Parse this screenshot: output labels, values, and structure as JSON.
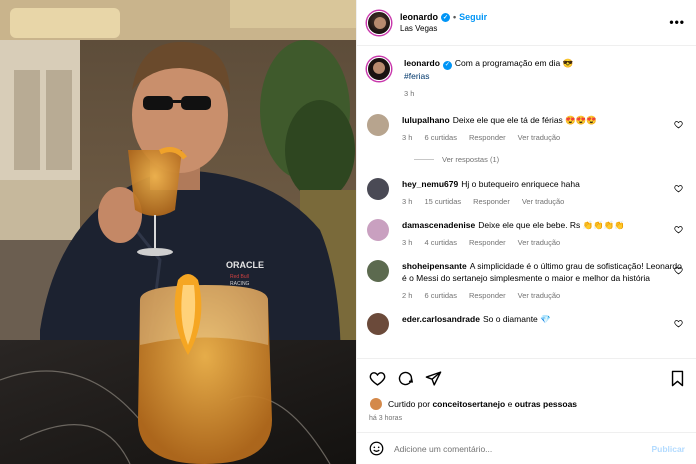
{
  "post": {
    "username": "leonardo",
    "follow_label": "Seguir",
    "separator": "•",
    "location": "Las Vegas",
    "more_icon": "more-horizontal-icon"
  },
  "caption": {
    "username": "leonardo",
    "text": "Com a programação em dia 😎",
    "hashtag": "#ferias",
    "time": "3 h"
  },
  "comments": [
    {
      "username": "lulupalhano",
      "text": "Deixe ele que ele tá de férias 😍😍😍",
      "time": "3 h",
      "likes": "6 curtidas",
      "reply": "Responder",
      "translate": "Ver tradução",
      "avatar_color": "#b7a48e"
    },
    {
      "username": "hey_nemu679",
      "text": "Hj o butequeiro enriquece haha",
      "time": "3 h",
      "likes": "15 curtidas",
      "reply": "Responder",
      "translate": "Ver tradução",
      "avatar_color": "#4a4a55"
    },
    {
      "username": "damascenadenise",
      "text": "Deixe ele que ele bebe. Rs 👏👏👏👏",
      "time": "3 h",
      "likes": "4 curtidas",
      "reply": "Responder",
      "translate": "Ver tradução",
      "avatar_color": "#c9a0c0"
    },
    {
      "username": "shoheipensante",
      "text": "A simplicidade é o último grau de sofisticação! Leonardo é o Messi do sertanejo simplesmente o maior e melhor da história",
      "time": "2 h",
      "likes": "6 curtidas",
      "reply": "Responder",
      "translate": "Ver tradução",
      "avatar_color": "#5c6a4f"
    },
    {
      "username": "eder.carlosandrade",
      "text": "So o diamante 💎",
      "time": "",
      "likes": "",
      "reply": "",
      "translate": "",
      "avatar_color": "#6b4a3a"
    }
  ],
  "view_replies": "Ver respostas (1)",
  "likes": {
    "prefix": "Curtido por",
    "user": "conceitosertanejo",
    "conj": "e",
    "others": "outras pessoas",
    "ago": "há 3 horas"
  },
  "composer": {
    "placeholder": "Adicione um comentário...",
    "publish_label": "Publicar"
  },
  "colors": {
    "accent": "#0095f6",
    "muted": "#737373",
    "story_ring": "#c837ab"
  }
}
